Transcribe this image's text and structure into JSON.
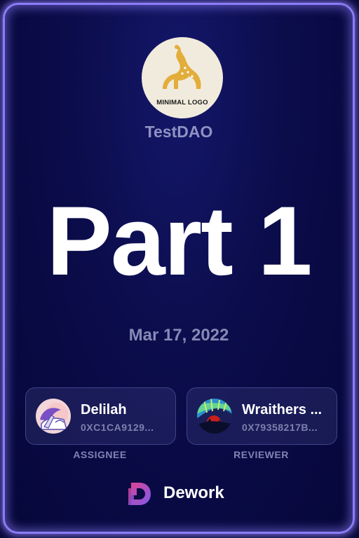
{
  "org": {
    "logo_text": "MINIMAL LOGO",
    "name": "TestDAO"
  },
  "task": {
    "title": "Part 1",
    "date": "Mar 17, 2022"
  },
  "assignee": {
    "name": "Delilah",
    "address": "0XC1CA9129...",
    "role": "ASSIGNEE"
  },
  "reviewer": {
    "name": "Wraithers ...",
    "address": "0X79358217B...",
    "role": "REVIEWER"
  },
  "brand": {
    "name": "Dework"
  },
  "colors": {
    "card_border": "#8b7cf6",
    "background": "#0b0c4a",
    "logo_accent": "#e3ad3b",
    "brand_gradient_start": "#e0418f",
    "brand_gradient_end": "#7a5cf0"
  }
}
